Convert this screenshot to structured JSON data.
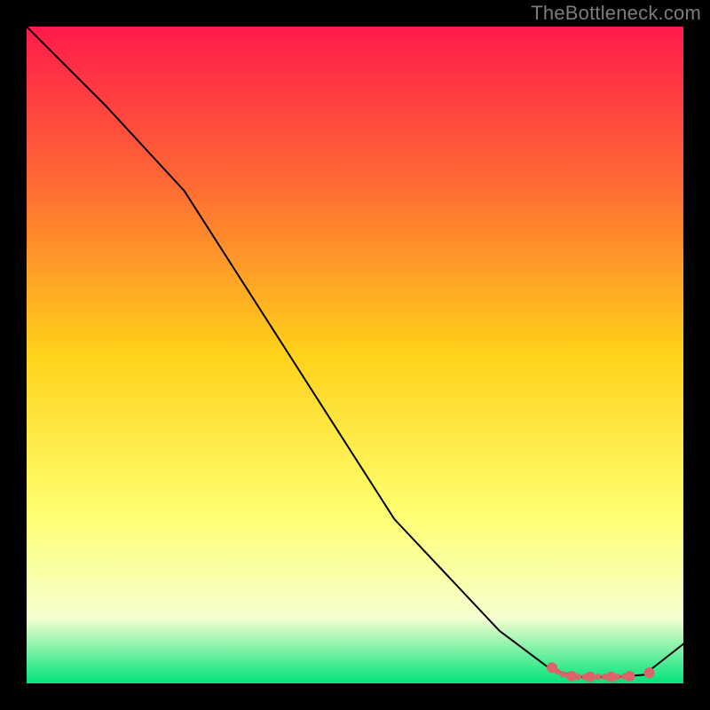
{
  "watermark": "TheBottleneck.com",
  "chart_data": {
    "type": "line",
    "title": "",
    "xlabel": "",
    "ylabel": "",
    "xlim": [
      0,
      100
    ],
    "ylim": [
      0,
      100
    ],
    "background_gradient": {
      "top": "#ff1a4b",
      "upper_mid": "#ff6a34",
      "mid": "#ffd21a",
      "lower_mid": "#ffff70",
      "lower": "#f6ffd0",
      "bottom": "#00e37a"
    },
    "series": [
      {
        "name": "curve",
        "stroke": "#000000",
        "stroke_width": 2,
        "points": [
          {
            "x": 0,
            "y": 100
          },
          {
            "x": 12,
            "y": 88
          },
          {
            "x": 24,
            "y": 75
          },
          {
            "x": 40,
            "y": 50
          },
          {
            "x": 56,
            "y": 25
          },
          {
            "x": 72,
            "y": 8
          },
          {
            "x": 80,
            "y": 2
          },
          {
            "x": 84,
            "y": 1
          },
          {
            "x": 90,
            "y": 1
          },
          {
            "x": 94,
            "y": 1.3
          },
          {
            "x": 100,
            "y": 6
          }
        ]
      }
    ],
    "marker_groups": [
      {
        "name": "near-min-markers",
        "color": "#d9656a",
        "radius_large": 6,
        "radius_small": 3.5,
        "points": [
          {
            "x": 80.0,
            "y": 2.4,
            "r": "large"
          },
          {
            "x": 80.8,
            "y": 1.8,
            "r": "small"
          },
          {
            "x": 81.6,
            "y": 1.4,
            "r": "small"
          },
          {
            "x": 82.4,
            "y": 1.2,
            "r": "small"
          },
          {
            "x": 83.0,
            "y": 1.1,
            "r": "large"
          },
          {
            "x": 84.0,
            "y": 1.0,
            "r": "small"
          },
          {
            "x": 85.0,
            "y": 1.0,
            "r": "small"
          },
          {
            "x": 85.8,
            "y": 1.0,
            "r": "large"
          },
          {
            "x": 87.0,
            "y": 1.0,
            "r": "small"
          },
          {
            "x": 88.0,
            "y": 1.0,
            "r": "small"
          },
          {
            "x": 89.0,
            "y": 1.0,
            "r": "large"
          },
          {
            "x": 90.0,
            "y": 1.0,
            "r": "small"
          },
          {
            "x": 91.0,
            "y": 1.05,
            "r": "small"
          },
          {
            "x": 91.8,
            "y": 1.1,
            "r": "large"
          },
          {
            "x": 94.8,
            "y": 1.6,
            "r": "large"
          }
        ]
      }
    ]
  }
}
